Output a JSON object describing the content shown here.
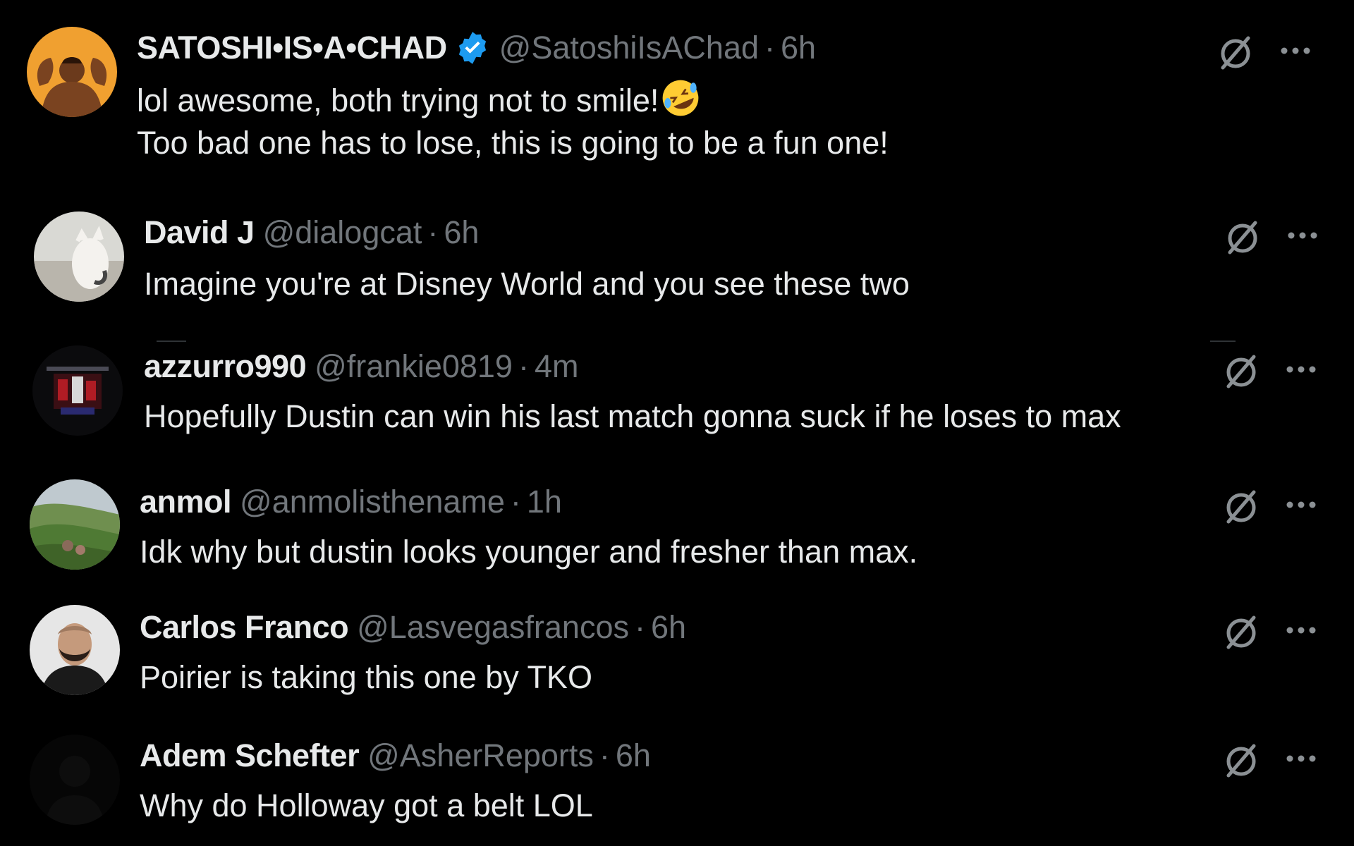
{
  "colors": {
    "background": "#000000",
    "text_primary": "#e7e9ea",
    "text_secondary": "#71767b",
    "verified_blue": "#1d9bf0"
  },
  "replies": [
    {
      "name": "SATOSHI•IS•A•CHAD",
      "verified": true,
      "handle": "@SatoshiIsAChad",
      "separator": "·",
      "time": "6h",
      "text_line1": "lol awesome, both trying not to smile!",
      "text_line1_emoji": "rolling-on-floor-laughing-emoji",
      "text_line2": "Too bad one has to lose, this is going to be a fun one!",
      "avatar": "satoshi-avatar"
    },
    {
      "name": "David J",
      "verified": false,
      "handle": "@dialogcat",
      "separator": "·",
      "time": "6h",
      "text_line1": "Imagine you're at Disney World and you see these two",
      "avatar": "david-avatar"
    },
    {
      "name": "azzurro990",
      "verified": false,
      "handle": "@frankie0819",
      "separator": "·",
      "time": "4m",
      "text_line1": "Hopefully Dustin can win his last match gonna suck if he loses to max",
      "avatar": "azzurro-avatar"
    },
    {
      "name": "anmol",
      "verified": false,
      "handle": "@anmolisthename",
      "separator": "·",
      "time": "1h",
      "text_line1": "Idk why but dustin looks younger and fresher than max.",
      "avatar": "anmol-avatar"
    },
    {
      "name": "Carlos Franco",
      "verified": false,
      "handle": "@Lasvegasfrancos",
      "separator": "·",
      "time": "6h",
      "text_line1": "Poirier is  taking this one by TKO",
      "avatar": "carlos-avatar"
    },
    {
      "name": "Adem Schefter",
      "verified": false,
      "handle": "@AsherReports",
      "separator": "·",
      "time": "6h",
      "text_line1": "Why do Holloway got a belt LOL",
      "avatar": "adem-avatar"
    }
  ],
  "icons": {
    "action": "grok-icon",
    "more": "more-options-icon"
  }
}
